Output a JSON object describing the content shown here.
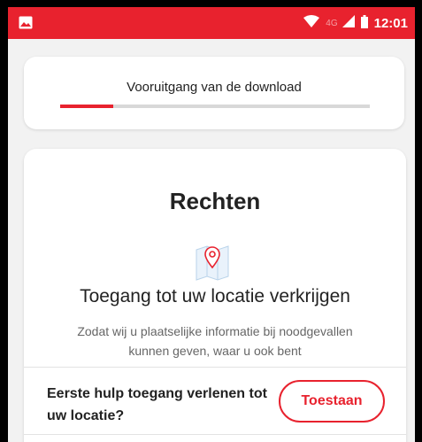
{
  "status_bar": {
    "network": "4G",
    "time": "12:01",
    "icons": [
      "image-icon",
      "wifi-icon",
      "signal-icon",
      "battery-icon"
    ]
  },
  "download": {
    "label": "Vooruitgang van de download",
    "progress": 0.17
  },
  "permissions": {
    "title": "Rechten",
    "icon": "map-pin-icon",
    "location_title": "Toegang tot uw locatie verkrijgen",
    "location_description": "Zodat wij u plaatselijke informatie bij noodgevallen kunnen geven, waar u ook bent",
    "prompt": "Eerste hulp toegang verlenen tot uw locatie?",
    "allow_label": "Toestaan"
  },
  "colors": {
    "accent": "#e8222e",
    "background": "#f2f2f2",
    "card": "#ffffff"
  }
}
